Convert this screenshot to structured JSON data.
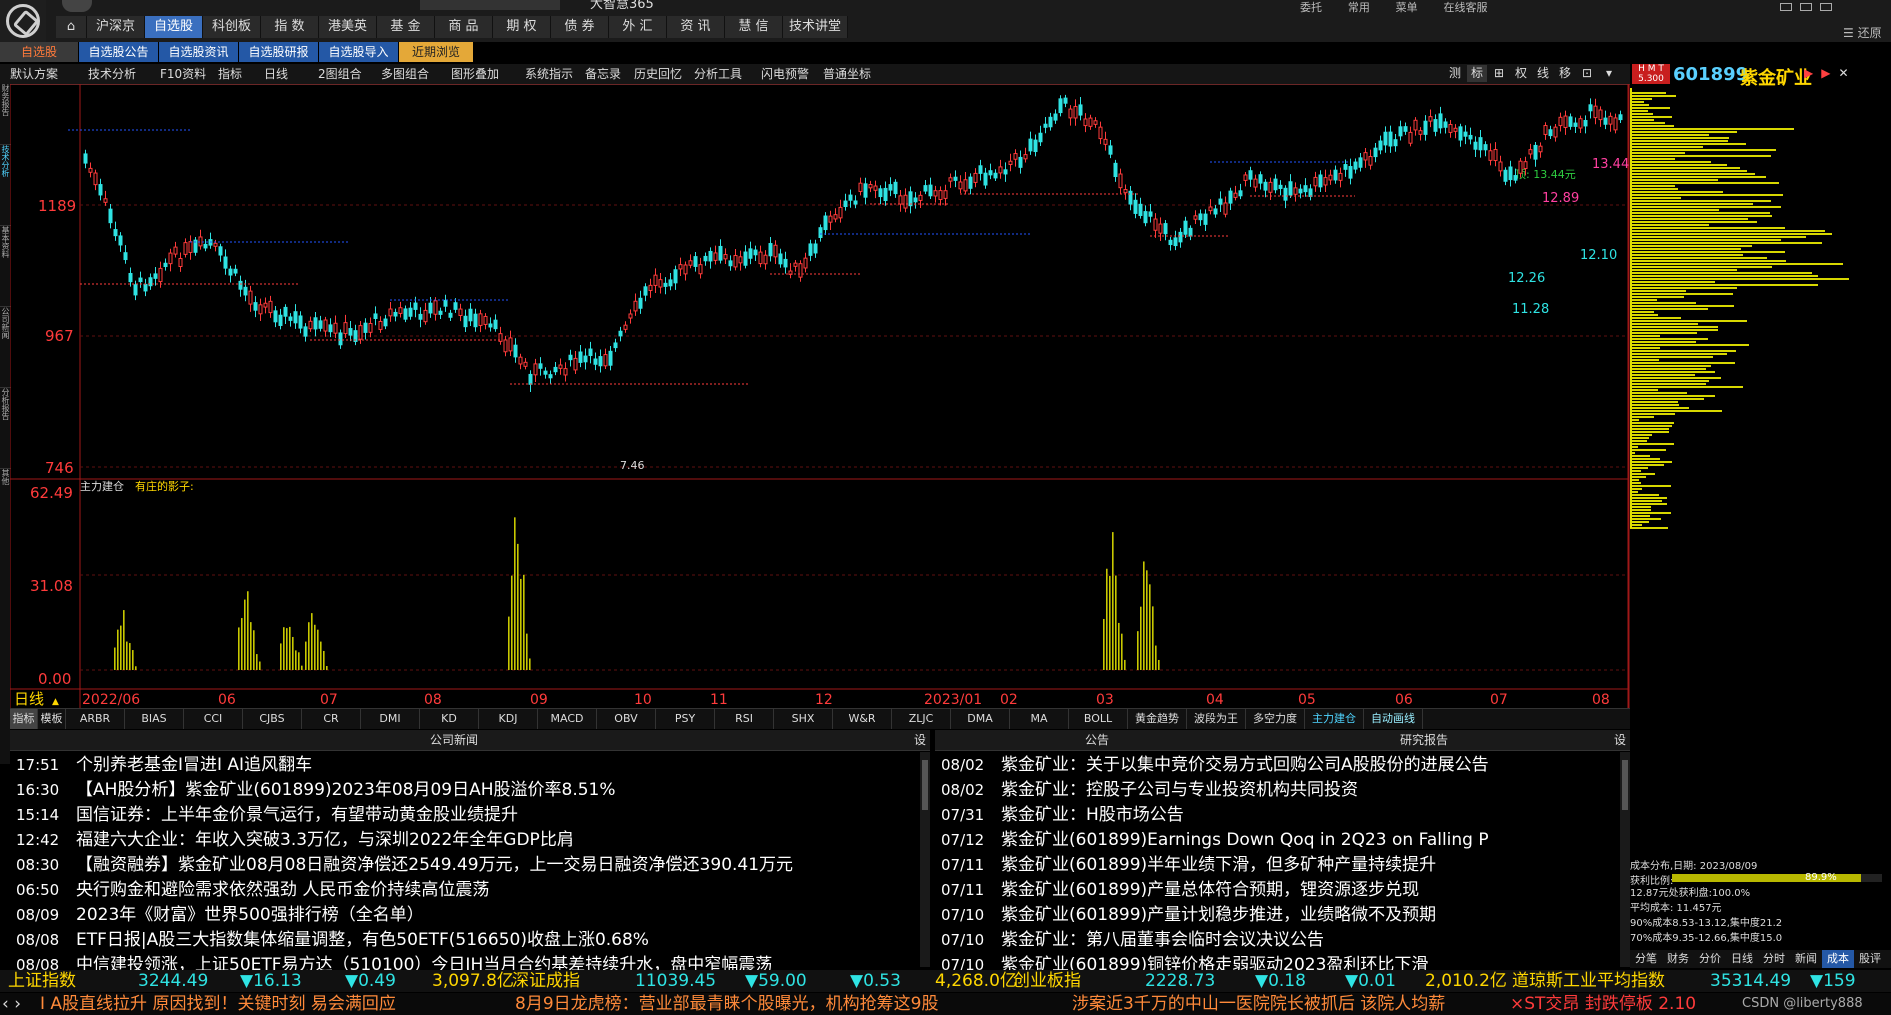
{
  "app": {
    "title": "大智慧365",
    "restore_label": "还原",
    "top_links": [
      "委托",
      "常用",
      "菜单",
      "在线客服"
    ]
  },
  "main_nav": [
    {
      "label": "沪深京",
      "active": false
    },
    {
      "label": "自选股",
      "active": true
    },
    {
      "label": "科创板",
      "active": false
    },
    {
      "label": "指 数",
      "active": false
    },
    {
      "label": "港美英",
      "active": false
    },
    {
      "label": "基 金",
      "active": false
    },
    {
      "label": "商 品",
      "active": false
    },
    {
      "label": "期 权",
      "active": false
    },
    {
      "label": "债 券",
      "active": false
    },
    {
      "label": "外 汇",
      "active": false
    },
    {
      "label": "资 讯",
      "active": false
    },
    {
      "label": "慧 信",
      "active": false
    },
    {
      "label": "技术讲堂",
      "active": false
    }
  ],
  "sub_nav": [
    "自选股",
    "自选股公告",
    "自选股资讯",
    "自选股研报",
    "自选股导入",
    "近期浏览"
  ],
  "toolbar": [
    "默认方案",
    "技术分析",
    "F10资料",
    "指标",
    "日线",
    "2图组合",
    "多图组合",
    "图形叠加",
    "系统指示",
    "备忘录",
    "历史回忆",
    "分析工具",
    "闪电预警",
    "普通坐标"
  ],
  "toolbar_right": [
    "测",
    "标",
    "⊞",
    "权",
    "线",
    "移",
    "⊡",
    "▾"
  ],
  "stock": {
    "code": "601899",
    "name": "紫金矿业",
    "tag": "H M T\n5.300"
  },
  "left_tabs": [
    "财务报告",
    "技术分析",
    "基本资料",
    "公司新闻",
    "分析报告",
    "其他"
  ],
  "chart": {
    "price_labels": [
      "1189",
      "967",
      "746"
    ],
    "annotations": {
      "high": "顶: 13.44元",
      "low": "7.46",
      "low2": "11.28",
      "mid1": "12.26",
      "mid2": "12.10",
      "mid3": "12.89",
      "top": "13.44"
    },
    "indicator_name": "主力建仓",
    "indicator_sub": "有庄的影子:",
    "ind_labels": [
      "62.49",
      "31.08",
      "0.00"
    ],
    "period_label": "日线",
    "date_labels": [
      "2022/06",
      "06",
      "07",
      "08",
      "09",
      "10",
      "11",
      "12",
      "2023/01",
      "02",
      "03",
      "04",
      "05",
      "06",
      "07",
      "08"
    ]
  },
  "chart_data": {
    "type": "candlestick",
    "title": "601899 紫金矿业 日线",
    "x_range": [
      "2022/05",
      "2023/08"
    ],
    "y_ticks": [
      746,
      967,
      1189
    ],
    "indicator": {
      "name": "主力建仓",
      "ticks": [
        0.0,
        31.08,
        62.49
      ]
    }
  },
  "indicator_tabs": [
    "指标",
    "模板",
    "ARBR",
    "BIAS",
    "CCI",
    "CJBS",
    "CR",
    "DMI",
    "KD",
    "KDJ",
    "MACD",
    "OBV",
    "PSY",
    "RSI",
    "SHX",
    "W&R",
    "ZLJC",
    "DMA",
    "MA",
    "BOLL",
    "黄金趋势",
    "波段为王",
    "多空力度",
    "主力建仓",
    "自动画线"
  ],
  "news_left": {
    "title": "公司新闻",
    "set_label": "设",
    "items": [
      {
        "time": "17:51",
        "text": "个别养老基金Ⅰ冒进Ⅰ AI追风翻车"
      },
      {
        "time": "16:30",
        "text": "【AH股分析】紫金矿业(601899)2023年08月09日AH股溢价率8.51%"
      },
      {
        "time": "15:14",
        "text": "国信证券：上半年金价景气运行，有望带动黄金股业绩提升"
      },
      {
        "time": "12:42",
        "text": "福建六大企业：年收入突破3.3万亿，与深圳2022年全年GDP比肩"
      },
      {
        "time": "08:30",
        "text": "【融资融券】紫金矿业08月08日融资净偿还2549.49万元，上一交易日融资净偿还390.41万元"
      },
      {
        "time": "06:50",
        "text": "央行购金和避险需求依然强劲 人民币金价持续高位震荡"
      },
      {
        "time": "08/09",
        "text": "2023年《财富》世界500强排行榜（全名单）"
      },
      {
        "time": "08/08",
        "text": "ETF日报|A股三大指数集体缩量调整，有色50ETF(516650)收盘上涨0.68%"
      },
      {
        "time": "08/08",
        "text": "中信建投领涨，上证50ETF易方达（510100）今日IH当月合约基差持续升水，盘中窄幅震荡"
      }
    ]
  },
  "news_right": {
    "title": "公告",
    "tab2": "研究报告",
    "set_label": "设",
    "items": [
      {
        "time": "08/02",
        "text": "紫金矿业：关于以集中竞价交易方式回购公司A股股份的进展公告"
      },
      {
        "time": "08/02",
        "text": "紫金矿业：控股子公司与专业投资机构共同投资"
      },
      {
        "time": "07/31",
        "text": "紫金矿业：H股市场公告"
      },
      {
        "time": "07/12",
        "text": "紫金矿业(601899)Earnings Down Qoq in 2Q23 on Falling P"
      },
      {
        "time": "07/11",
        "text": "紫金矿业(601899)半年业绩下滑，但多矿种产量持续提升"
      },
      {
        "time": "07/11",
        "text": "紫金矿业(601899)产量总体符合预期，锂资源逐步兑现"
      },
      {
        "time": "07/10",
        "text": "紫金矿业(601899)产量计划稳步推进，业绩略微不及预期"
      },
      {
        "time": "07/10",
        "text": "紫金矿业：第八届董事会临时会议决议公告"
      },
      {
        "time": "07/10",
        "text": "紫金矿业(601899)铜锌价格走弱驱动2023盈利环比下滑"
      }
    ]
  },
  "cost": {
    "header": "成本分布,日期: 2023/08/09",
    "profit_ratio_label": "获利比例:",
    "profit_ratio": "89.9%",
    "lines": [
      "12.87元处获利盘:100.0%",
      "平均成本: 11.457元",
      "90%成本8.53-13.12,集中度21.2",
      "70%成本9.35-12.66,集中度15.0"
    ],
    "tabs": [
      "分笔",
      "财务",
      "分价",
      "日线",
      "分时",
      "新闻",
      "成本",
      "股评"
    ]
  },
  "ticker1": [
    {
      "name": "上证指数",
      "value": "3244.49",
      "change": "▼16.13",
      "pct": "▼0.49",
      "amount": "3,097.8亿"
    },
    {
      "name": "深证成指",
      "value": "11039.45",
      "change": "▼59.00",
      "pct": "▼0.53",
      "amount": "4,268.0亿"
    },
    {
      "name": "创业板指",
      "value": "2228.73",
      "change": "▼0.18",
      "pct": "▼0.01",
      "amount": "2,010.2亿"
    },
    {
      "name": "道琼斯工业平均指数",
      "value": "35314.49",
      "change": "▼159",
      "pct": "",
      "amount": ""
    }
  ],
  "ticker2": [
    "I A股直线拉升 原因找到！关键时刻 易会满回应",
    "8月9日龙虎榜：营业部最青睐个股曝光，机构抢筹这9股",
    "涉案近3千万的中山一医院院长被抓后 该院人均薪",
    "×ST交昂 封跌停板 2.10"
  ],
  "watermark": "CSDN @liberty888",
  "colors": {
    "up": "#ff3b3b",
    "down": "#2fe3e3",
    "ma_blue": "#2255ff",
    "volume_bar": "#c8c800",
    "cost_bar": "#d8d800",
    "nav_active": "#3a6fbf",
    "subnav": "#2458a6"
  }
}
